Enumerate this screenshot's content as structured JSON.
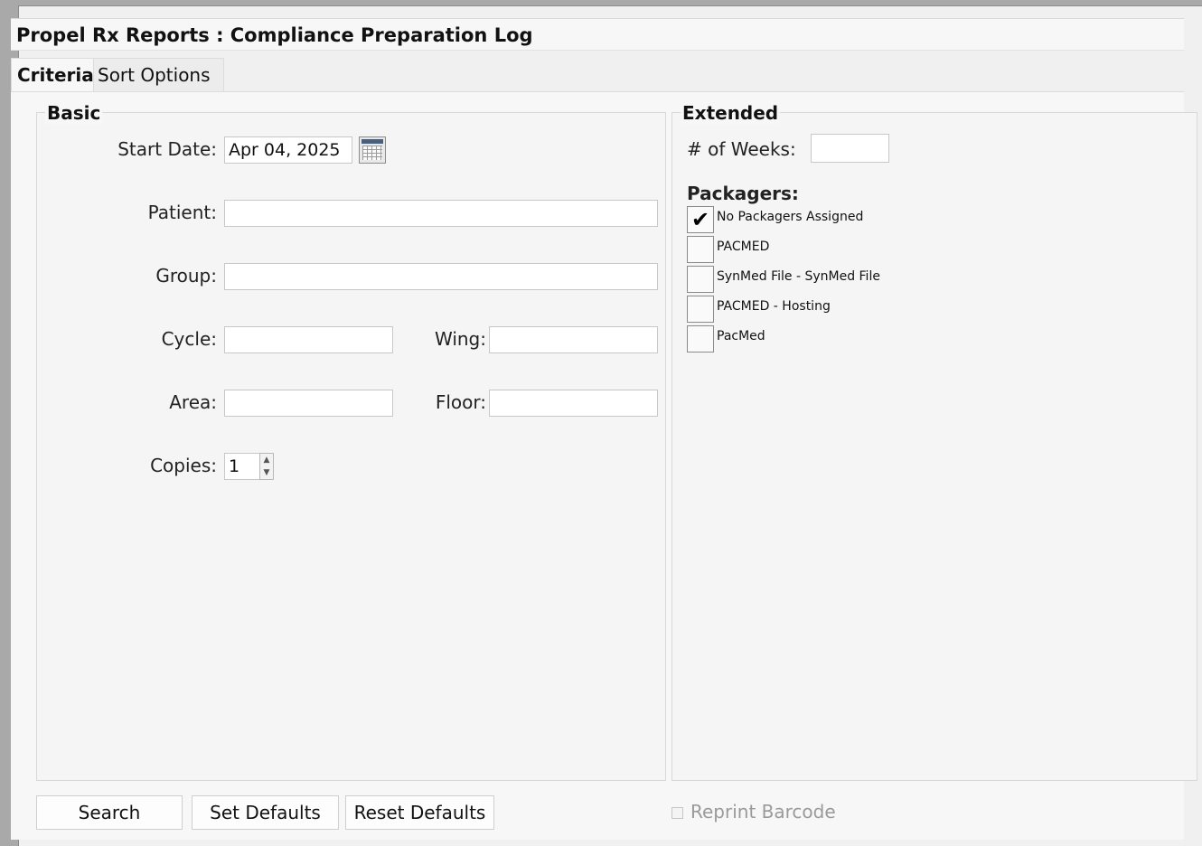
{
  "window": {
    "title": "Propel Rx Reports : Compliance Preparation Log"
  },
  "tabs": [
    {
      "label": "Criteria",
      "active": true
    },
    {
      "label": "Sort Options",
      "active": false
    }
  ],
  "basic": {
    "title": "Basic",
    "start_date_label": "Start Date:",
    "start_date_value": "Apr 04, 2025",
    "patient_label": "Patient:",
    "patient_value": "",
    "group_label": "Group:",
    "group_value": "",
    "cycle_label": "Cycle:",
    "cycle_value": "",
    "wing_label": "Wing:",
    "wing_value": "",
    "area_label": "Area:",
    "area_value": "",
    "floor_label": "Floor:",
    "floor_value": "",
    "copies_label": "Copies:",
    "copies_value": "1"
  },
  "extended": {
    "title": "Extended",
    "weeks_label": "# of Weeks:",
    "weeks_value": "",
    "packagers_label": "Packagers:",
    "packagers": [
      {
        "label": "No Packagers Assigned",
        "checked": true
      },
      {
        "label": "PACMED",
        "checked": false
      },
      {
        "label": "SynMed File - SynMed File",
        "checked": false
      },
      {
        "label": "PACMED - Hosting",
        "checked": false
      },
      {
        "label": "PacMed",
        "checked": false
      }
    ],
    "checkmark": "✔"
  },
  "buttons": {
    "search": "Search",
    "set_defaults": "Set Defaults",
    "reset_defaults": "Reset Defaults"
  },
  "reprint": {
    "label": "Reprint Barcode",
    "checked": false,
    "enabled": false
  },
  "icons": {
    "calendar": "calendar-icon",
    "spin_up": "▲",
    "spin_down": "▼"
  }
}
